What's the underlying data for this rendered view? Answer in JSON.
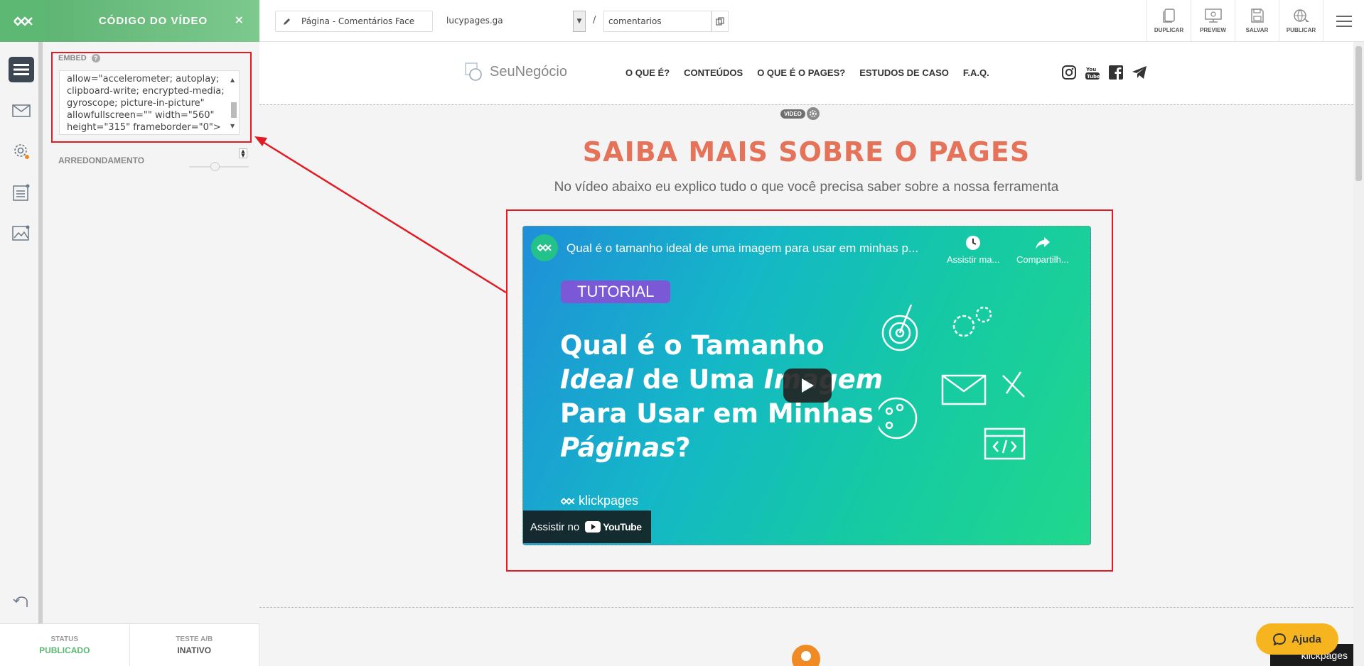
{
  "panel": {
    "title": "CÓDIGO DO VÍDEO",
    "close": "×",
    "embed_label": "EMBED",
    "embed_lines": [
      "allow=\"accelerometer; autoplay;",
      "clipboard-write; encrypted-media;",
      "gyroscope; picture-in-picture\"",
      "allowfullscreen=\"\" width=\"560\"",
      "height=\"315\" frameborder=\"0\">"
    ],
    "round_label": "ARREDONDAMENTO"
  },
  "status": {
    "status_key": "STATUS",
    "status_value": "PUBLICADO",
    "ab_key": "TESTE A/B",
    "ab_value": "INATIVO"
  },
  "toolbar": {
    "page_name": "Página - Comentários Face",
    "domain": "lucypages.ga",
    "slash": "/",
    "slug": "comentarios",
    "buttons": [
      {
        "label": "DUPLICAR",
        "icon": "duplicate-icon"
      },
      {
        "label": "PREVIEW",
        "icon": "preview-icon"
      },
      {
        "label": "SALVAR",
        "icon": "save-icon"
      },
      {
        "label": "PUBLICAR",
        "icon": "publish-icon"
      }
    ]
  },
  "site": {
    "brand": "SeuNegócio",
    "nav": [
      "O QUE É?",
      "CONTEÚDOS",
      "O QUE É O PAGES?",
      "ESTUDOS DE CASO",
      "F.A.Q."
    ],
    "socials": [
      "instagram-icon",
      "youtube-icon",
      "facebook-icon",
      "telegram-icon"
    ]
  },
  "section": {
    "badge": "VIDEO",
    "title": "SAIBA MAIS SOBRE O PAGES",
    "subtitle": "No vídeo abaixo eu explico tudo o que você precisa saber sobre a nossa ferramenta"
  },
  "video": {
    "title": "Qual é o tamanho ideal de uma imagem para usar em minhas p...",
    "watch_later": "Assistir ma...",
    "share": "Compartilh...",
    "tag": "TUTORIAL",
    "headline": {
      "l1": "Qual é o Tamanho",
      "l2a": "Ideal",
      "l2b": " de Uma ",
      "l2c": "Imagem",
      "l3": "Para Usar em Minhas",
      "l4a": "Páginas",
      "l4b": "?"
    },
    "brand": "klickpages",
    "watch_on": "Assistir no",
    "yt": "YouTube"
  },
  "help": {
    "label": "Ajuda"
  },
  "footer_tag": "klickpages",
  "colors": {
    "accent_green": "#5cb873",
    "title_orange": "#e5735a",
    "highlight_red": "#e01b24",
    "help_yellow": "#f6b51e"
  }
}
